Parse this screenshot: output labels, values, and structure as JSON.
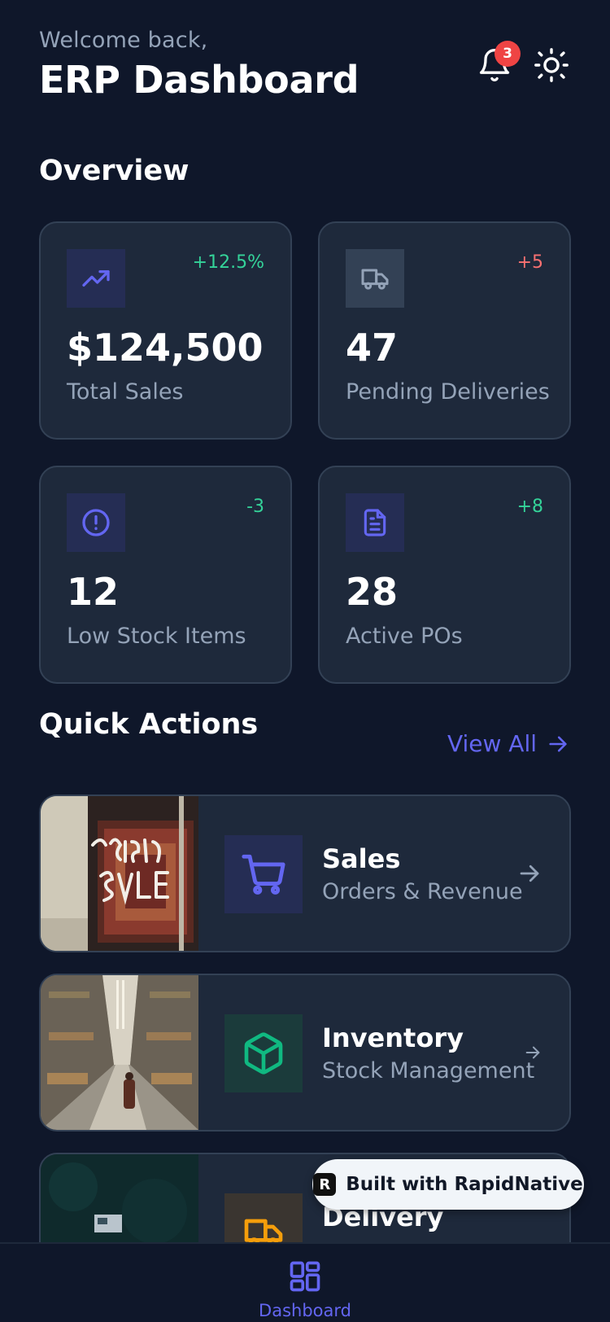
{
  "header": {
    "welcome": "Welcome back,",
    "title": "ERP Dashboard",
    "notification_count": "3"
  },
  "overview": {
    "title": "Overview",
    "stats": [
      {
        "value": "$124,500",
        "label": "Total Sales",
        "change": "+12.5%",
        "change_color": "#34d399",
        "icon": "trending-up-icon"
      },
      {
        "value": "47",
        "label": "Pending Deliveries",
        "change": "+5",
        "change_color": "#f87171",
        "icon": "truck-icon"
      },
      {
        "value": "12",
        "label": "Low Stock Items",
        "change": "-3",
        "change_color": "#34d399",
        "icon": "alert-circle-icon"
      },
      {
        "value": "28",
        "label": "Active POs",
        "change": "+8",
        "change_color": "#34d399",
        "icon": "file-text-icon"
      }
    ]
  },
  "quick_actions": {
    "title": "Quick Actions",
    "view_all": "View All",
    "items": [
      {
        "title": "Sales",
        "subtitle": "Orders & Revenue",
        "icon": "shopping-cart-icon",
        "accent": "#6366f1"
      },
      {
        "title": "Inventory",
        "subtitle": "Stock Management",
        "icon": "package-icon",
        "accent": "#10b981"
      },
      {
        "title": "Delivery",
        "subtitle": "",
        "icon": "truck-icon",
        "accent": "#f59e0b"
      }
    ]
  },
  "bottom_nav": {
    "dashboard_label": "Dashboard"
  },
  "badge": {
    "text": "Built with RapidNative"
  }
}
